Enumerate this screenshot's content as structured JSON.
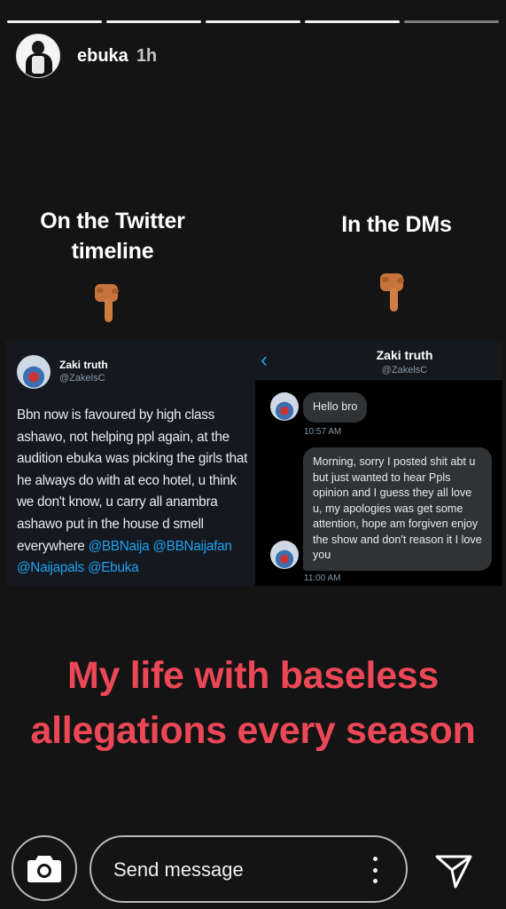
{
  "story": {
    "progress": {
      "segments": 5,
      "completed": 4
    },
    "user": {
      "username": "ebuka",
      "time_ago": "1h"
    }
  },
  "captions": {
    "left": "On the Twitter timeline",
    "right": "In the DMs",
    "bottom": "My life with baseless allegations every season",
    "bottom_color": "#ec4756"
  },
  "tweet": {
    "name": "Zaki truth",
    "handle": "@ZakelsC",
    "text": "Bbn now is favoured by high class ashawo, not helping ppl again, at the audition ebuka was picking the girls that he always do with at eco hotel,  u think we don't know,  u carry all anambra ashawo put in the house d smell everywhere ",
    "mentions": "@BBNaija @BBNaijafan @Naijapals @Ebuka",
    "mention_color": "#1da1f2"
  },
  "dm": {
    "back_icon": "‹",
    "name": "Zaki truth",
    "handle": "@ZakelsC",
    "messages": [
      {
        "text": "Hello bro",
        "time": "10:57 AM"
      },
      {
        "text": "Morning, sorry I posted shit abt u but just wanted to hear Ppls opinion and I guess they all love u,  my apologies was get  some attention,  hope am forgiven enjoy the show and don't reason it I love you",
        "time": "11:00 AM"
      }
    ]
  },
  "reply_bar": {
    "placeholder": "Send message",
    "icons": {
      "camera": "camera-icon",
      "more": "more-vertical-icon",
      "send": "send-icon"
    }
  }
}
